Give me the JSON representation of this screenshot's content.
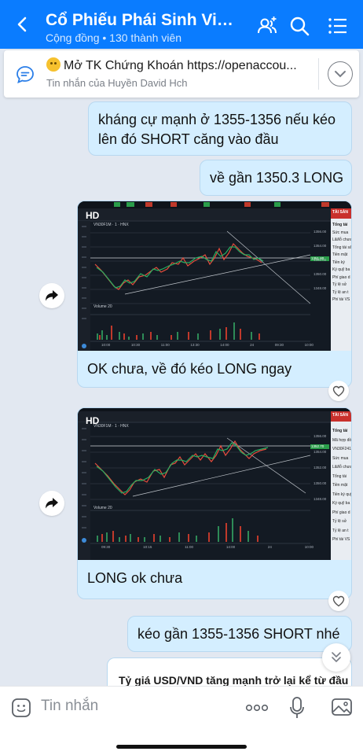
{
  "header": {
    "title": "Cổ Phiếu Phái Sinh Vippro...",
    "subtitle": "Cộng đồng • 130 thành viên"
  },
  "pinned": {
    "title": "Mở TK Chứng Khoán https://openaccou...",
    "subtitle": "Tin nhắn của Huyền David Hch"
  },
  "messages": [
    {
      "text": "kháng cự mạnh ở 1355-1356 nếu kéo lên đó SHORT căng vào đầu"
    },
    {
      "text": "về gần 1350.3 LONG"
    },
    {
      "text": "OK chưa, về đó kéo LONG ngay",
      "image": "chart-screenshot"
    },
    {
      "text": "LONG ok chưa",
      "image": "chart-screenshot"
    },
    {
      "text": "kéo gần 1355-1356 SHORT nhé"
    }
  ],
  "preview": {
    "text": "Tỷ giá USD/VND tăng mạnh trở lại kể từ đầu"
  },
  "composer": {
    "placeholder": "Tin nhắn"
  },
  "chart1": {
    "hd": "HD",
    "symbol": "VN30F1M · 1 · HNX",
    "side_title": "TÀI SẢN",
    "side_rows": [
      "Tổng tài",
      "Sức mua",
      "Lãi/lỗ chưa",
      "Tổng tài sản",
      "Tiền mặt",
      "Tiền ký",
      "Ký quỹ ba",
      "Phí giao d",
      "Tỷ lệ sử",
      "Tỷ lệ an t",
      "Phí tài VS"
    ],
    "ticks_x": [
      "10:00",
      "10:30",
      "11:00",
      "13:30",
      "14:00",
      "24",
      "09:30",
      "10:00"
    ],
    "ticks_y": [
      "1356.00",
      "1354.00",
      "1352.00",
      "1350.00",
      "1348.00"
    ],
    "volume_label": "Volume 20",
    "price_tag": "1351.80"
  },
  "chart2": {
    "hd": "HD",
    "symbol": "VN30F1M · 1 · HNX",
    "side_title": "TÀI SẢN",
    "side_rows": [
      "Tổng tài",
      "Mã hợp đồ",
      "VN30F241",
      "Sức mua",
      "Lãi/lỗ chưa",
      "Tổng tài",
      "Tiền mặt",
      "Tiền ký quỹ",
      "Ký quỹ ba",
      "Phí giao d",
      "Tỷ lệ sử",
      "Tỷ lệ an t",
      "Phí tài VS"
    ],
    "ticks_x": [
      "09:30",
      "10:15",
      "11:00",
      "14:00",
      "24",
      "10:00"
    ],
    "ticks_y": [
      "1356.00",
      "1354.00",
      "1352.00",
      "1350.00",
      "1348.00"
    ],
    "volume_label": "Volume 20",
    "price_tag": "1352.70"
  }
}
